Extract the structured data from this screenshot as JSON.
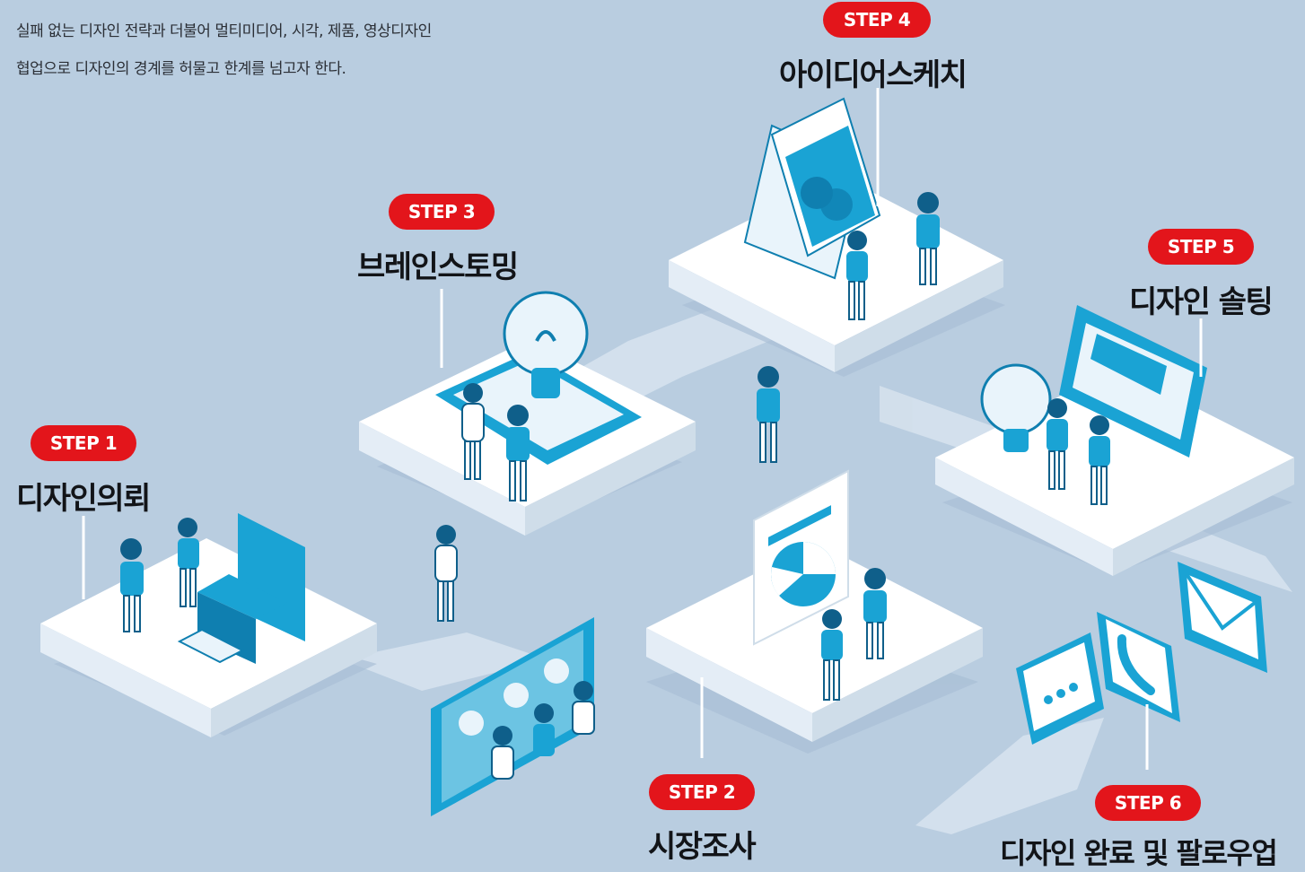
{
  "intro": {
    "line1": "실패 없는 디자인 전략과 더불어 멀티미디어, 시각, 제품, 영상디자인",
    "line2": "협업으로 디자인의 경계를 허물고 한계를 넘고자 한다."
  },
  "steps": [
    {
      "badge": "STEP 1",
      "title": "디자인의뢰"
    },
    {
      "badge": "STEP 2",
      "title": "시장조사"
    },
    {
      "badge": "STEP 3",
      "title": "브레인스토밍"
    },
    {
      "badge": "STEP 4",
      "title": "아이디어스케치"
    },
    {
      "badge": "STEP 5",
      "title": "디자인 솔팅"
    },
    {
      "badge": "STEP 6",
      "title": "디자인 완료 및 팔로우업"
    }
  ],
  "colors": {
    "background": "#b9cde0",
    "badge": "#e3151b",
    "accent": "#1aa3d4",
    "platform": "#ffffff",
    "title": "#121418"
  },
  "icons": [
    "lightbulb-icon",
    "chat-bubble-icon",
    "phone-icon",
    "mail-icon",
    "pie-chart-icon",
    "monitor-icon",
    "sketchbook-icon",
    "sofa-icon",
    "whiteboard-icon"
  ]
}
